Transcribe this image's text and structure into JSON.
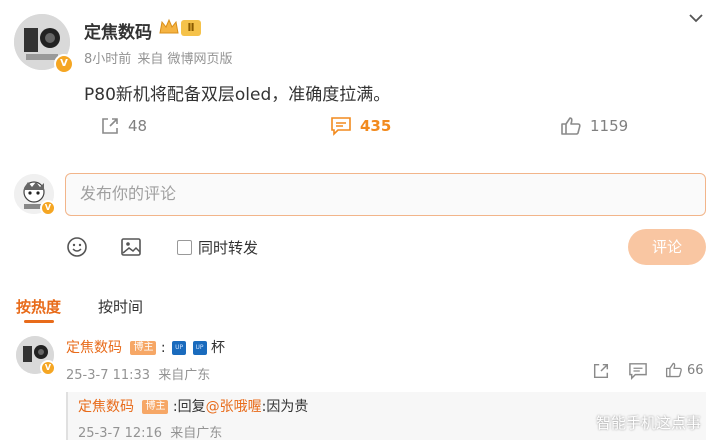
{
  "post": {
    "author": "定焦数码",
    "level_badge": "Ⅱ",
    "time": "8小时前",
    "source": "来自 微博网页版",
    "content": "P80新机将配备双层oled，准确度拉满。",
    "reposts": "48",
    "comments": "435",
    "likes": "1159"
  },
  "composer": {
    "placeholder": "发布你的评论",
    "repost_label": "同时转发",
    "submit_label": "评论"
  },
  "sort_tabs": {
    "hot": "按热度",
    "time": "按时间"
  },
  "comment": {
    "author": "定焦数码",
    "author_tag": "博主",
    "text_prefix": ":",
    "emoji_label": "UP",
    "text_suffix": "杯",
    "time": "25-3-7 11:33",
    "location": "来自广东",
    "likes": "66",
    "reply": {
      "author": "定焦数码",
      "author_tag": "博主",
      "reply_prefix": ":回复",
      "mention": "@张哦喔",
      "text": ":因为贵",
      "time": "25-3-7 12:16",
      "location": "来自广东"
    }
  },
  "watermark": "智能手机这点事",
  "colors": {
    "accent": "#e86b1a",
    "input_border": "#f2b58a",
    "button_disabled": "#f9c6a2"
  }
}
